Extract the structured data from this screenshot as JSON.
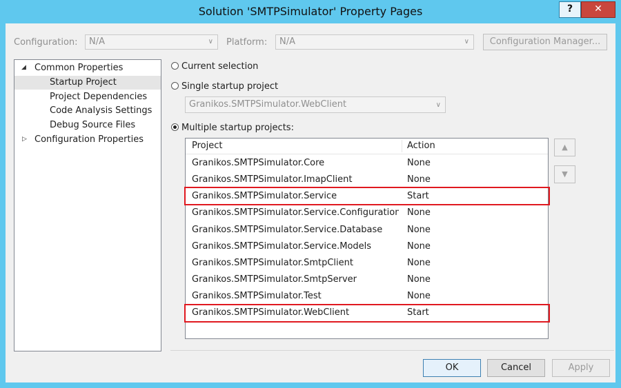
{
  "window": {
    "title": "Solution 'SMTPSimulator' Property Pages",
    "help_label": "?",
    "close_label": "✕"
  },
  "config_bar": {
    "configuration_label": "Configuration:",
    "configuration_value": "N/A",
    "platform_label": "Platform:",
    "platform_value": "N/A",
    "config_manager_label": "Configuration Manager..."
  },
  "tree": {
    "common": "Common Properties",
    "items": [
      "Startup Project",
      "Project Dependencies",
      "Code Analysis Settings",
      "Debug Source Files"
    ],
    "configuration": "Configuration Properties"
  },
  "startup": {
    "current_selection": "Current selection",
    "single_startup": "Single startup project",
    "single_value": "Granikos.SMTPSimulator.WebClient",
    "multiple_startup": "Multiple startup projects:"
  },
  "list": {
    "col_project": "Project",
    "col_action": "Action",
    "rows": [
      {
        "project": "Granikos.SMTPSimulator.Core",
        "action": "None"
      },
      {
        "project": "Granikos.SMTPSimulator.ImapClient",
        "action": "None"
      },
      {
        "project": "Granikos.SMTPSimulator.Service",
        "action": "Start"
      },
      {
        "project": "Granikos.SMTPSimulator.Service.Configuration...",
        "action": "None"
      },
      {
        "project": "Granikos.SMTPSimulator.Service.Database",
        "action": "None"
      },
      {
        "project": "Granikos.SMTPSimulator.Service.Models",
        "action": "None"
      },
      {
        "project": "Granikos.SMTPSimulator.SmtpClient",
        "action": "None"
      },
      {
        "project": "Granikos.SMTPSimulator.SmtpServer",
        "action": "None"
      },
      {
        "project": "Granikos.SMTPSimulator.Test",
        "action": "None"
      },
      {
        "project": "Granikos.SMTPSimulator.WebClient",
        "action": "Start"
      }
    ]
  },
  "buttons": {
    "ok": "OK",
    "cancel": "Cancel",
    "apply": "Apply"
  },
  "colors": {
    "titlebar": "#5fc8ee",
    "highlight": "#e0181f",
    "close": "#c9463d"
  }
}
